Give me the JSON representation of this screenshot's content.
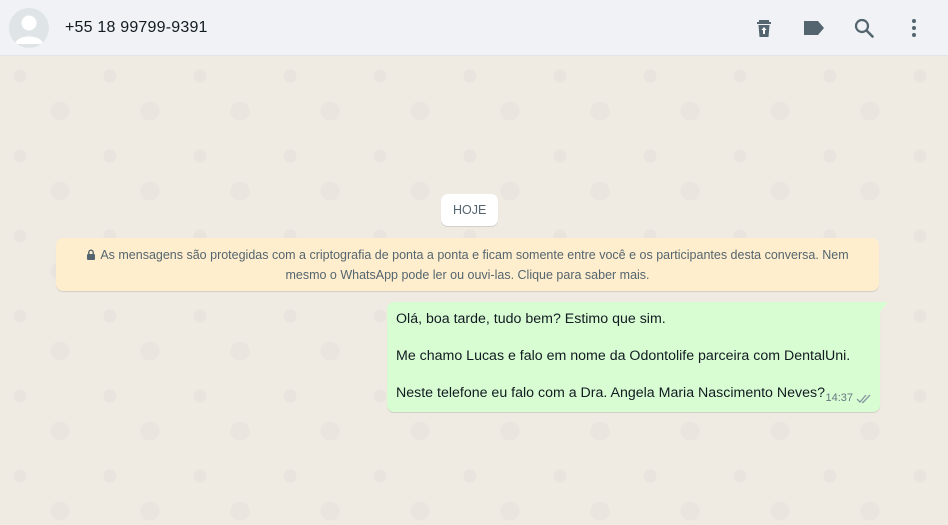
{
  "header": {
    "contact_name": "+55 18 99799-9391",
    "actions": [
      "trash-icon",
      "label-icon",
      "search-icon",
      "menu-icon"
    ]
  },
  "chat": {
    "date_chip": "HOJE",
    "encryption_notice": "As mensagens são protegidas com a criptografia de ponta a ponta e ficam somente entre você e os participantes desta conversa. Nem mesmo o WhatsApp pode ler ou ouvi-las. Clique para saber mais.",
    "messages": [
      {
        "lines": [
          "Olá, boa tarde, tudo bem? Estimo que sim.",
          "Me chamo Lucas e falo em nome da Odontolife parceira com DentalUni.",
          "Neste telefone eu falo com a Dra. Angela Maria Nascimento Neves?"
        ],
        "time": "14:37",
        "status": "double-check-icon"
      }
    ]
  },
  "colors": {
    "header_bg": "#f0f2f5",
    "chat_bg": "#efeae2",
    "outgoing_bubble": "#d9fdd3",
    "encryption_bg": "#ffeecd",
    "icon_gray": "#54656f"
  }
}
